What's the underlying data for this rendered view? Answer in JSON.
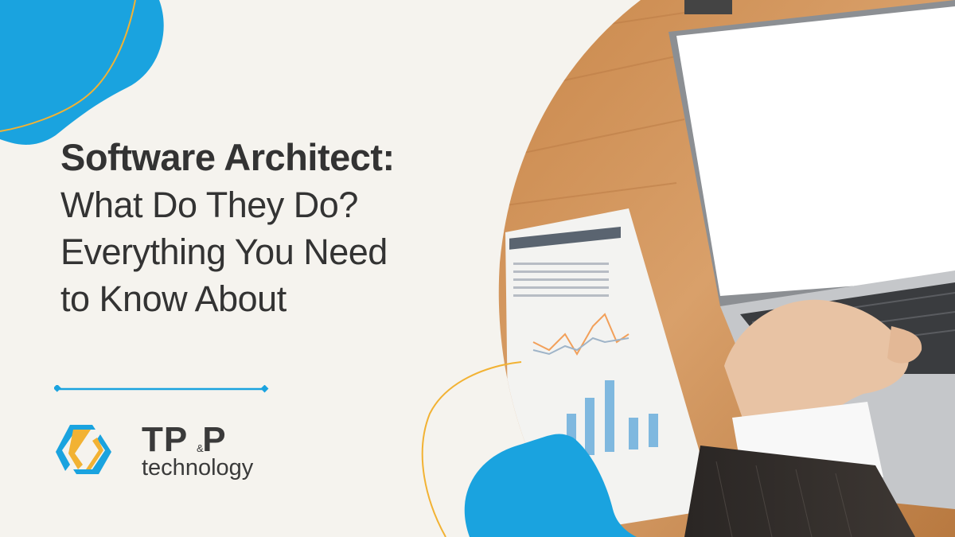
{
  "headline": {
    "line1": "Software Architect:",
    "line2": "What Do They Do?",
    "line3": "Everything You Need",
    "line4": "to Know About"
  },
  "brand": {
    "name_main": "TP",
    "name_amp": "&",
    "name_end": "P",
    "subtitle": "technology"
  },
  "colors": {
    "background": "#f5f3ee",
    "accent_blue": "#1aa3df",
    "accent_orange": "#f2b233",
    "text": "#333333"
  },
  "icons": [
    "tpp-logo-icon",
    "laptop-photo",
    "report-paper"
  ]
}
